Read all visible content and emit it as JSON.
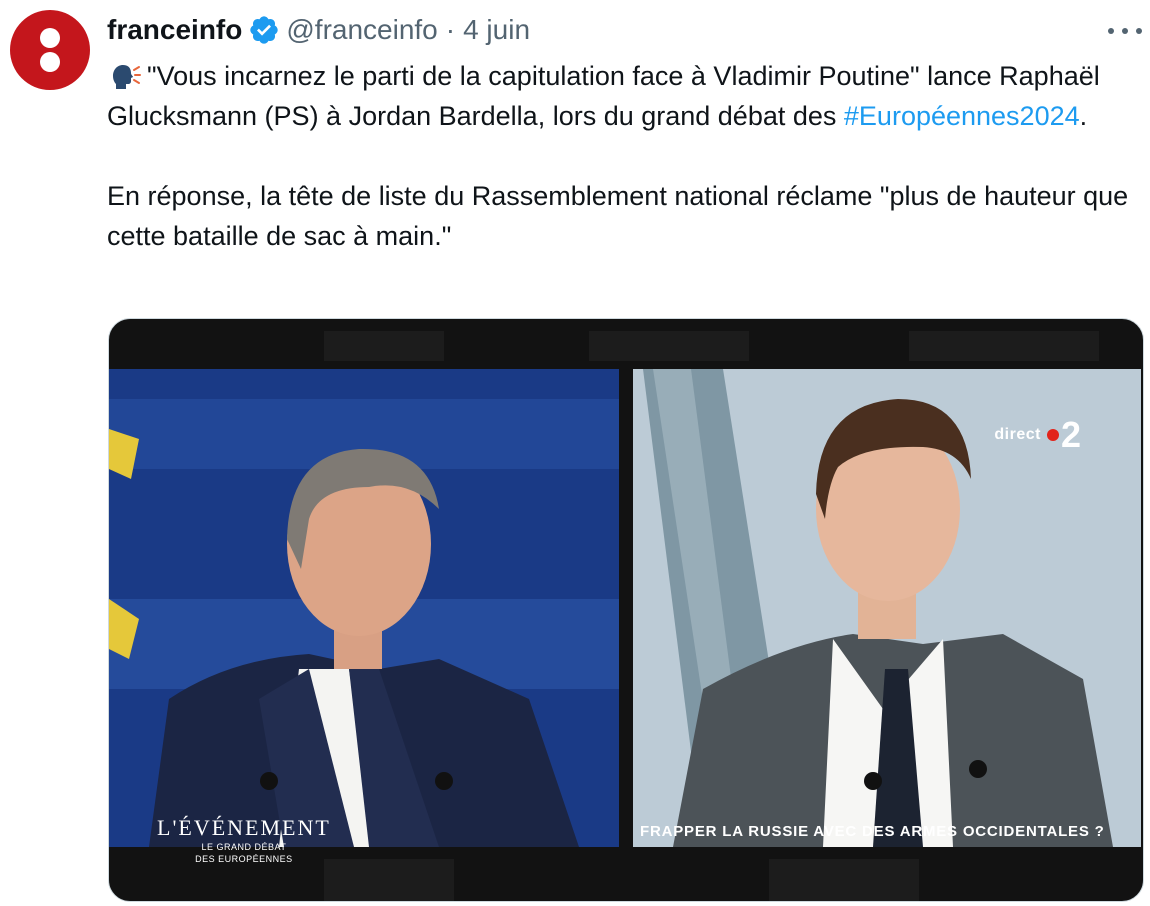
{
  "author": {
    "name": "franceinfo",
    "handle": "@franceinfo",
    "separator": "·",
    "date": "4 juin",
    "avatar_color": "#c4161c",
    "verified_color": "#1d9bf0"
  },
  "menu": {
    "icon": "more-horizontal-icon"
  },
  "tweet": {
    "lead_icon": "speaking-head-icon",
    "line1": "\"Vous incarnez le parti de la capitulation face à Vladimir Poutine\" lance Raphaël Glucksmann (PS) à Jordan Bardella, lors du grand débat des ",
    "hashtag": "#Européennes2024",
    "line1_end": ".",
    "line2": "En réponse, la tête de liste du Rassemblement national réclame \"plus de hauteur que cette bataille de sac à main.\""
  },
  "media": {
    "channel_label": "direct",
    "channel_number": "2",
    "caption": "FRAPPER LA RUSSIE AVEC DES ARMES OCCIDENTALES ?",
    "show_title": "L'ÉVÉNEMENT",
    "show_subtitle_1": "LE GRAND DÉBAT",
    "show_subtitle_2": "DES EUROPÉENNES"
  }
}
